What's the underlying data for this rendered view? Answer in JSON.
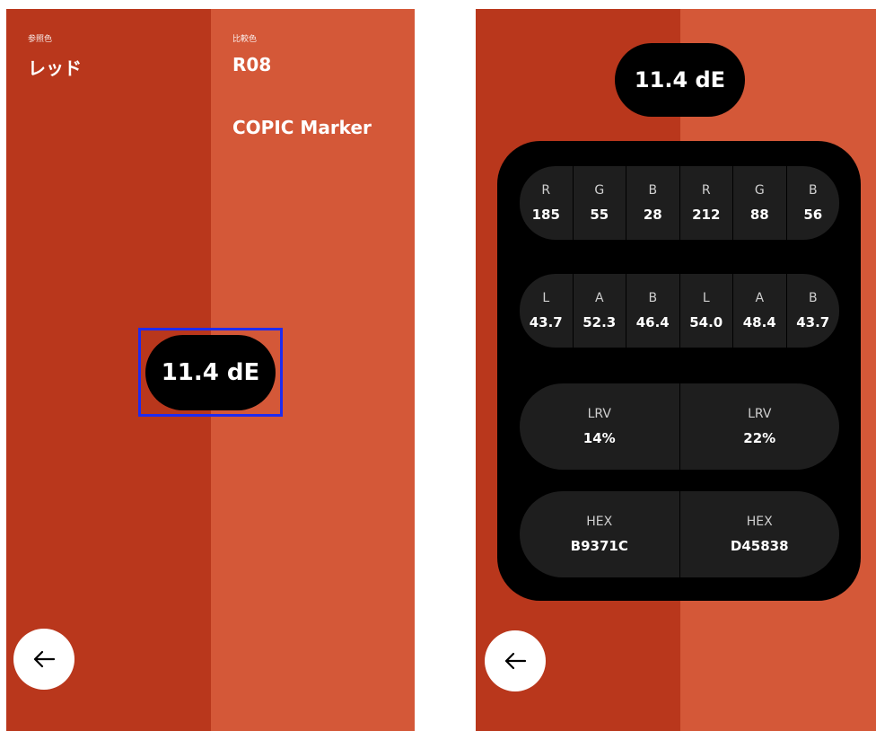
{
  "colors": {
    "reference": "#B9371C",
    "comparison": "#D45838",
    "pill": "#000000",
    "highlight": "#1E2BF0"
  },
  "screen1": {
    "reference_caption": "参照色",
    "reference_name": "レッド",
    "comparison_caption": "比較色",
    "comparison_code": "R08",
    "comparison_brand": "COPIC Marker",
    "delta_e": "11.4 dE",
    "back_icon": "arrow-left-icon"
  },
  "screen2": {
    "delta_e": "11.4 dE",
    "rgb": [
      {
        "label": "R",
        "value": "185"
      },
      {
        "label": "G",
        "value": "55"
      },
      {
        "label": "B",
        "value": "28"
      },
      {
        "label": "R",
        "value": "212"
      },
      {
        "label": "G",
        "value": "88"
      },
      {
        "label": "B",
        "value": "56"
      }
    ],
    "lab": [
      {
        "label": "L",
        "value": "43.7"
      },
      {
        "label": "A",
        "value": "52.3"
      },
      {
        "label": "B",
        "value": "46.4"
      },
      {
        "label": "L",
        "value": "54.0"
      },
      {
        "label": "A",
        "value": "48.4"
      },
      {
        "label": "B",
        "value": "43.7"
      }
    ],
    "lrv": [
      {
        "label": "LRV",
        "value": "14%"
      },
      {
        "label": "LRV",
        "value": "22%"
      }
    ],
    "hex": [
      {
        "label": "HEX",
        "value": "B9371C"
      },
      {
        "label": "HEX",
        "value": "D45838"
      }
    ],
    "back_icon": "arrow-left-icon"
  }
}
